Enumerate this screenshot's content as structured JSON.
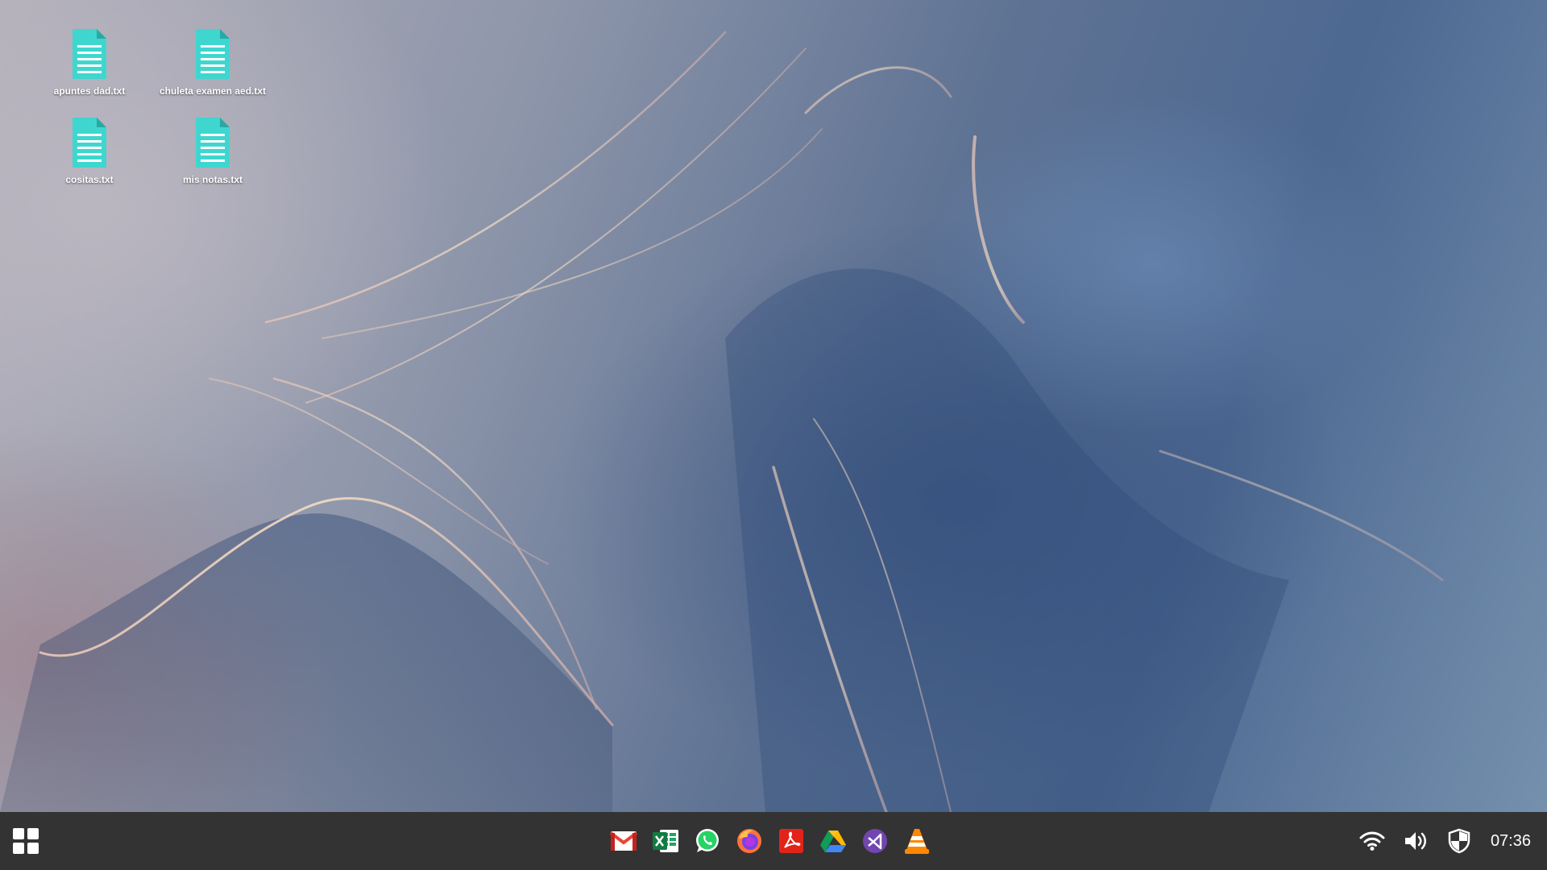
{
  "desktop": {
    "icons": [
      {
        "label": "apuntes dad.txt",
        "icon": "text-file-icon"
      },
      {
        "label": "chuleta examen aed.txt",
        "icon": "text-file-icon"
      },
      {
        "label": "cositas.txt",
        "icon": "text-file-icon"
      },
      {
        "label": "mis notas.txt",
        "icon": "text-file-icon"
      }
    ]
  },
  "taskbar": {
    "start_icon": "windows-grid-icon",
    "apps": [
      {
        "name": "Gmail",
        "icon": "gmail-icon"
      },
      {
        "name": "Excel",
        "icon": "excel-icon"
      },
      {
        "name": "WhatsApp",
        "icon": "whatsapp-icon"
      },
      {
        "name": "Firefox",
        "icon": "firefox-icon"
      },
      {
        "name": "Acrobat Reader",
        "icon": "acrobat-icon"
      },
      {
        "name": "Google Drive",
        "icon": "google-drive-icon"
      },
      {
        "name": "Visual Studio",
        "icon": "visual-studio-icon"
      },
      {
        "name": "VLC",
        "icon": "vlc-icon"
      }
    ],
    "tray": {
      "icons": [
        "wifi-icon",
        "volume-icon",
        "security-shield-icon"
      ],
      "clock": "07:36"
    }
  },
  "colors": {
    "taskbar_bg": "#333333",
    "file_icon": "#3fd6d0"
  }
}
